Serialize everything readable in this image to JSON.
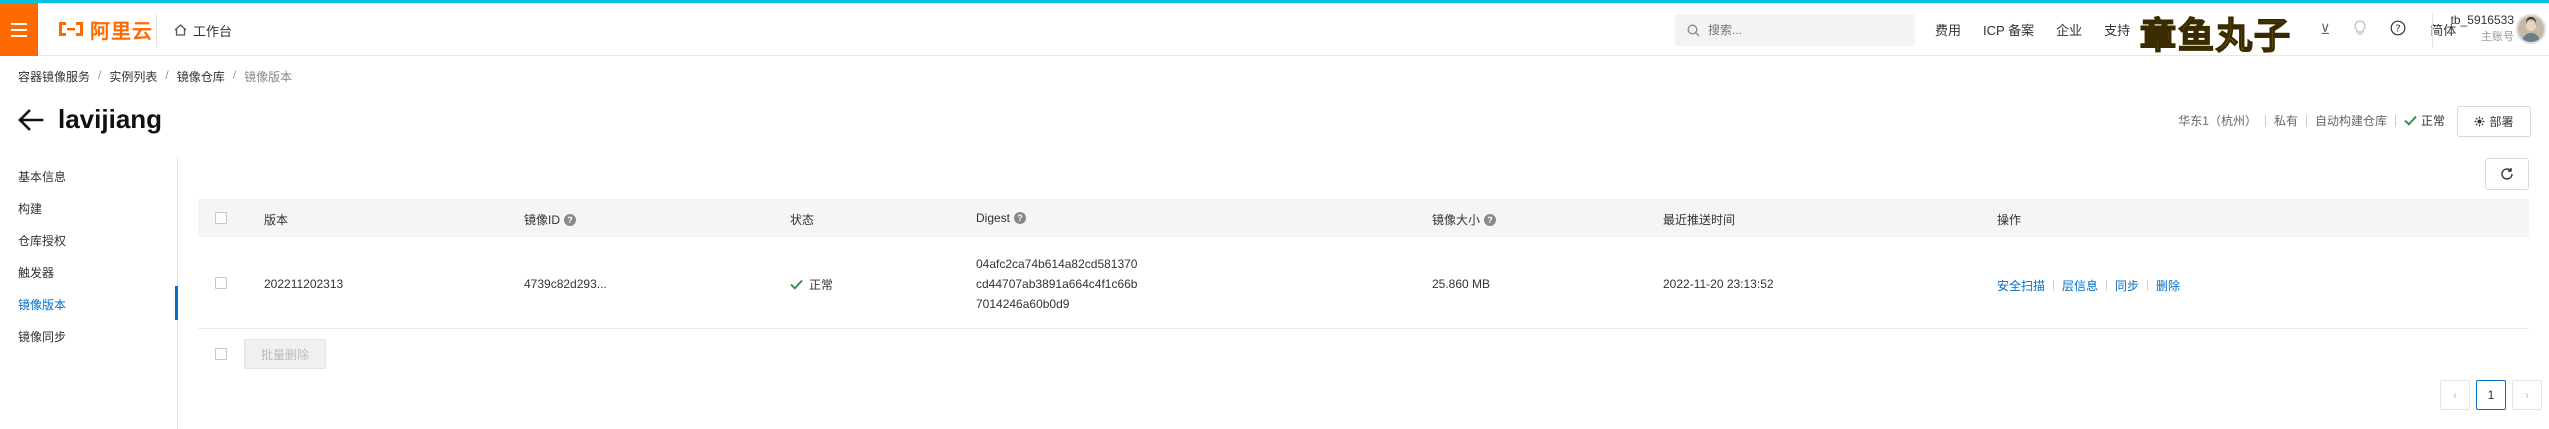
{
  "topbar": {
    "brand": "阿里云",
    "workbench_label": "工作台",
    "search_placeholder": "搜索...",
    "links": [
      "费用",
      "ICP 备案",
      "企业",
      "支持",
      "工"
    ],
    "watermark": "章鱼丸子",
    "lang": "简体",
    "user_name": "tb_5916533",
    "user_role": "主账号"
  },
  "breadcrumb": [
    "容器镜像服务",
    "实例列表",
    "镜像仓库",
    "镜像版本"
  ],
  "page": {
    "title": "lavijiang",
    "meta_region": "华东1（杭州）",
    "meta_visibility": "私有",
    "meta_build": "自动构建仓库",
    "meta_status": "正常",
    "deploy_label": "部署"
  },
  "sidebar": {
    "items": [
      {
        "label": "基本信息"
      },
      {
        "label": "构建"
      },
      {
        "label": "仓库授权"
      },
      {
        "label": "触发器"
      },
      {
        "label": "镜像版本"
      },
      {
        "label": "镜像同步"
      }
    ]
  },
  "table": {
    "headers": {
      "version": "版本",
      "image_id": "镜像ID",
      "status": "状态",
      "digest": "Digest",
      "size": "镜像大小",
      "pushed": "最近推送时间",
      "ops": "操作"
    },
    "rows": [
      {
        "version": "202211202313",
        "image_id": "4739c82d293...",
        "status": "正常",
        "digest_lines": [
          "04afc2ca74b614a82cd581370",
          "cd44707ab3891a664c4f1c66b",
          "7014246a60b0d9"
        ],
        "size": "25.860 MB",
        "pushed": "2022-11-20 23:13:52",
        "ops": [
          "安全扫描",
          "层信息",
          "同步",
          "删除"
        ]
      }
    ],
    "bulk_delete_label": "批量删除"
  },
  "pagination": {
    "prev": "‹",
    "current": "1",
    "next": "›"
  },
  "colors": {
    "brand_orange": "#ff6a00",
    "link_blue": "#0070cc",
    "success_green": "#1e8e3e"
  }
}
